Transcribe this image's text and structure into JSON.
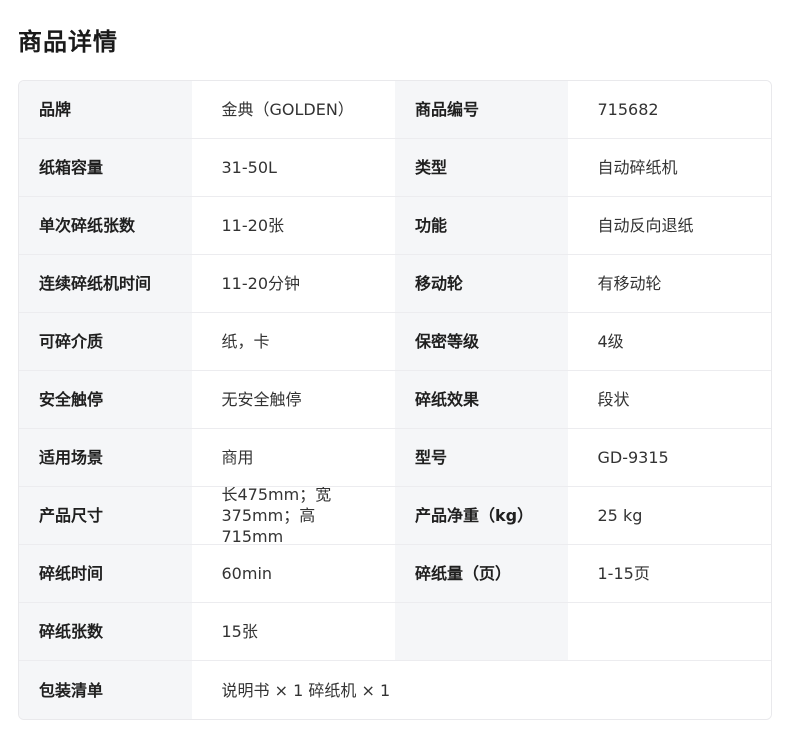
{
  "page": {
    "title": "商品详情"
  },
  "specs": {
    "rows": [
      {
        "left_label": "品牌",
        "left_value": "金典（GOLDEN）",
        "right_label": "商品编号",
        "right_value": "715682"
      },
      {
        "left_label": "纸箱容量",
        "left_value": "31-50L",
        "right_label": "类型",
        "right_value": "自动碎纸机"
      },
      {
        "left_label": "单次碎纸张数",
        "left_value": "11-20张",
        "right_label": "功能",
        "right_value": "自动反向退纸"
      },
      {
        "left_label": "连续碎纸机时间",
        "left_value": "11-20分钟",
        "right_label": "移动轮",
        "right_value": "有移动轮"
      },
      {
        "left_label": "可碎介质",
        "left_value": "纸，卡",
        "right_label": "保密等级",
        "right_value": "4级"
      },
      {
        "left_label": "安全触停",
        "left_value": "无安全触停",
        "right_label": "碎纸效果",
        "right_value": "段状"
      },
      {
        "left_label": "适用场景",
        "left_value": "商用",
        "right_label": "型号",
        "right_value": "GD-9315"
      },
      {
        "left_label": "产品尺寸",
        "left_value": "长475mm；宽375mm；高715mm",
        "right_label": "产品净重（kg）",
        "right_value": "25 kg"
      },
      {
        "left_label": "碎纸时间",
        "left_value": "60min",
        "right_label": "碎纸量（页）",
        "right_value": "1-15页"
      },
      {
        "left_label": "碎纸张数",
        "left_value": "15张",
        "right_label": "",
        "right_value": ""
      }
    ],
    "package": {
      "label": "包装清单",
      "value": "说明书 × 1 碎纸机 × 1"
    }
  }
}
